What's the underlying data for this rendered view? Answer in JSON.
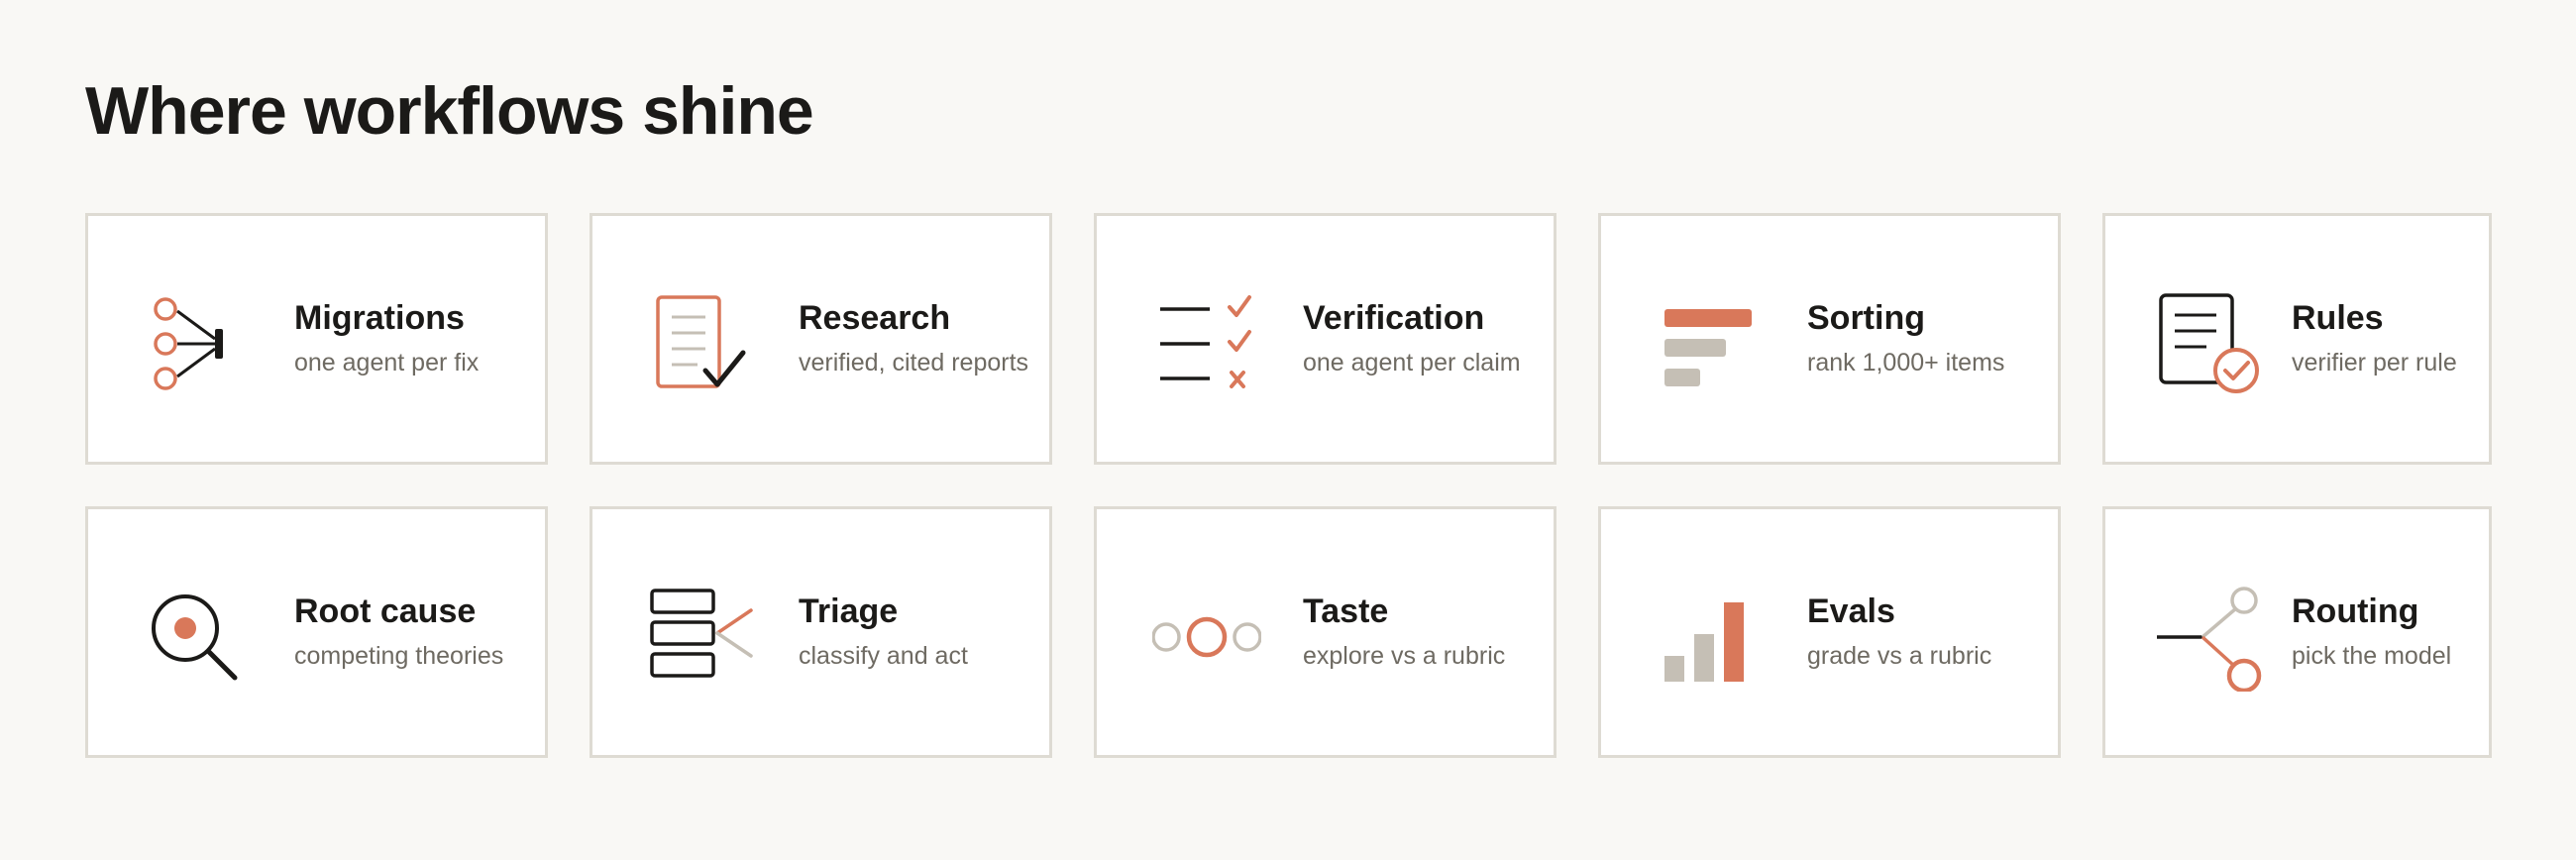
{
  "heading": "Where workflows shine",
  "colors": {
    "accent": "#d9785a",
    "dark": "#1b1a18",
    "muted": "#c5bfb5",
    "border": "#dedbd3",
    "background": "#f9f8f5"
  },
  "cards": [
    {
      "title": "Migrations",
      "subtitle": "one agent per fix",
      "icon": "fan-out-icon"
    },
    {
      "title": "Research",
      "subtitle": "verified, cited reports",
      "icon": "document-check-icon"
    },
    {
      "title": "Verification",
      "subtitle": "one agent per claim",
      "icon": "checklist-icon"
    },
    {
      "title": "Sorting",
      "subtitle": "rank 1,000+ items",
      "icon": "sort-bars-icon"
    },
    {
      "title": "Rules",
      "subtitle": "verifier per rule",
      "icon": "rules-document-icon"
    },
    {
      "title": "Root cause",
      "subtitle": "competing theories",
      "icon": "magnifier-icon"
    },
    {
      "title": "Triage",
      "subtitle": "classify and act",
      "icon": "triage-stack-icon"
    },
    {
      "title": "Taste",
      "subtitle": "explore vs a rubric",
      "icon": "circles-icon"
    },
    {
      "title": "Evals",
      "subtitle": "grade vs a rubric",
      "icon": "bar-chart-icon"
    },
    {
      "title": "Routing",
      "subtitle": "pick the model",
      "icon": "branch-icon"
    }
  ]
}
